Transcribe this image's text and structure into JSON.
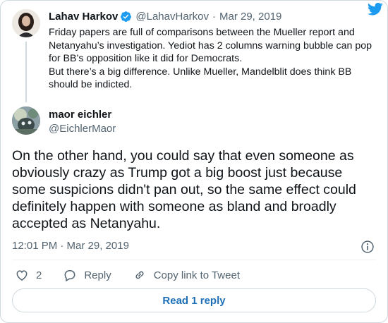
{
  "parent_tweet": {
    "author_name": "Lahav Harkov",
    "author_handle": "@LahavHarkov",
    "separator": "·",
    "date": "Mar 29, 2019",
    "text_lines": [
      "Friday papers are full of comparisons between the Mueller report and Netanyahu’s investigation. Yediot has 2 columns warning bubble can pop for BB’s opposition like it did for Democrats.",
      "But there’s a big difference. Unlike Mueller, Mandelblit does think BB should be indicted."
    ],
    "verified": true
  },
  "main_tweet": {
    "author_name": "maor eichler",
    "author_handle": "@EichlerMaor",
    "text": "On the other hand, you could say that even someone as obviously crazy as Trump got a big boost just because some suspicions didn't pan out, so the same effect could definitely happen with someone as bland and broadly accepted as Netanyahu.",
    "timestamp": "12:01 PM · Mar 29, 2019"
  },
  "actions": {
    "like_count": "2",
    "reply_label": "Reply",
    "copy_link_label": "Copy link to Tweet"
  },
  "footer": {
    "read_replies_label": "Read 1 reply"
  },
  "icons": {
    "brand": "twitter-bird-icon",
    "verified": "verified-badge-icon",
    "info": "info-icon",
    "like": "heart-icon",
    "reply": "reply-bubble-icon",
    "copy": "link-icon"
  },
  "colors": {
    "brand_blue": "#1d9bf0",
    "link_blue": "#1d6fb8",
    "secondary_text": "#536471",
    "border": "#cfd9de"
  }
}
